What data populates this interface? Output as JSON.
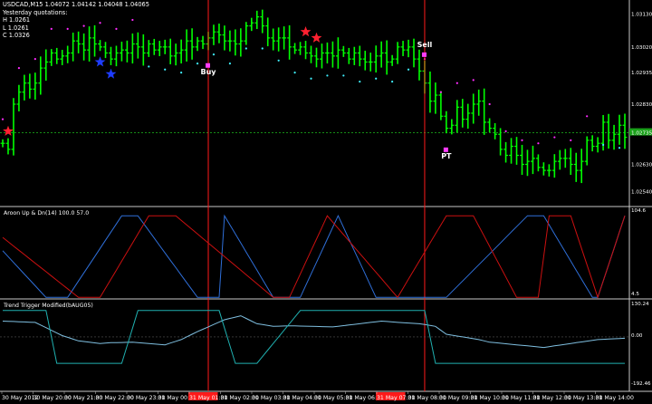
{
  "window": {
    "symbol_title": "USDCAD,M15",
    "ohlc_text": "1.04072 1.04142 1.04048 1.04065",
    "quote_lines": [
      "Yesterday quotations:",
      "H 1.0261",
      "L 1.0261",
      "C 1.0326"
    ]
  },
  "panels": {
    "aroon_title": "Aroon Up & Dn(14) 100.0 57.0",
    "trend_title": "Trend Trigger Modified(bAUG05)",
    "aroon_ticks": [
      "104.6",
      "4.5"
    ],
    "trend_ticks": [
      "130.24",
      "0.00",
      "-192.46"
    ]
  },
  "colors": {
    "bull": "#00ff00",
    "bear": "#ff0000",
    "aroon_up": "#2f6fd9",
    "aroon_dn": "#cc1010",
    "trend_line": "#7fbfe0",
    "trend_trigger": "#20b0b0",
    "grid": "#8a8a8a",
    "magenta_dots": "#ff2bff",
    "cyan_dots": "#3ff0ff",
    "vline": "#ff1a1a",
    "badge": "#ff1a1a",
    "signal_bar": "#ff3cff"
  },
  "chart_data": [
    {
      "type": "line",
      "title": "USDCAD,M15",
      "series_kind": "bar_chart",
      "price_labels": [
        "1.03130",
        "1.03020",
        "1.02935",
        "1.02830",
        "1.02735",
        "1.02735",
        "1.02630",
        "1.02540"
      ],
      "current_price": "1.02735",
      "ylim": [
        1.0249,
        1.0317
      ],
      "x_labels": [
        "30 May 2012",
        "30 May 20:00",
        "30 May 21:00",
        "30 May 22:00",
        "30 May 23:00",
        "31 May 00:00",
        "31 May 01:00",
        "31 May 02:00",
        "31 May 03:00",
        "31 May 04:00",
        "31 May 05:00",
        "31 May 06:00",
        "31 May 07:00",
        "31 May 08:00",
        "31 May 09:00",
        "31 May 10:00",
        "31 May 11:00",
        "31 May 12:00",
        "31 May 13:00",
        "31 May 14:00"
      ],
      "highlighted_x_labels": [
        "31 May 01:00",
        "31 May 07:00"
      ],
      "annotations": [
        {
          "text": "PT",
          "at": "31 May 03:00"
        },
        {
          "text": "Buy",
          "at": "31 May 00:45"
        },
        {
          "text": "Sell",
          "at": "31 May 07:15"
        },
        {
          "text": "PT",
          "at": "31 May 08:15"
        }
      ],
      "vertical_lines_at": [
        "31 May 00:45",
        "31 May 07:15"
      ],
      "closes": [
        1.027,
        1.0268,
        1.0283,
        1.0287,
        1.029,
        1.0288,
        1.029,
        1.0295,
        1.0297,
        1.03,
        1.0298,
        1.0299,
        1.03,
        1.0304,
        1.0303,
        1.0301,
        1.0305,
        1.0303,
        1.0302,
        1.03,
        1.0298,
        1.03,
        1.0301,
        1.03,
        1.0303,
        1.0302,
        1.03,
        1.0303,
        1.0301,
        1.0302,
        1.0302,
        1.0299,
        1.03,
        1.0301,
        1.0304,
        1.0302,
        1.0304,
        1.0303,
        1.0305,
        1.0307,
        1.0306,
        1.0304,
        1.0304,
        1.0303,
        1.0304,
        1.0309,
        1.031,
        1.0312,
        1.0309,
        1.0305,
        1.0304,
        1.0305,
        1.0305,
        1.0302,
        1.0301,
        1.0302,
        1.03,
        1.0299,
        1.0298,
        1.03,
        1.03,
        1.0299,
        1.0301,
        1.03,
        1.0298,
        1.03,
        1.0298,
        1.0297,
        1.0297,
        1.0299,
        1.03,
        1.0297,
        1.0298,
        1.0302,
        1.0301,
        1.0302,
        1.0298,
        1.0294,
        1.029,
        1.0284,
        1.0286,
        1.0279,
        1.0275,
        1.0276,
        1.0282,
        1.0278,
        1.028,
        1.0283,
        1.0284,
        1.0277,
        1.0275,
        1.0273,
        1.0268,
        1.0266,
        1.0269,
        1.0266,
        1.0263,
        1.0264,
        1.0265,
        1.0262,
        1.0261,
        1.0261,
        1.0264,
        1.0265,
        1.0265,
        1.0263,
        1.0261,
        1.0264,
        1.0271,
        1.0269,
        1.027,
        1.0277,
        1.0271,
        1.0273,
        1.0276,
        1.0272
      ]
    },
    {
      "type": "line",
      "title": "Aroon Up & Dn(14) 100.0 57.0",
      "ylim": [
        4.5,
        104.6
      ],
      "series": [
        {
          "name": "Aroon Up",
          "anchors_x": [
            0,
            8,
            12,
            22,
            25,
            36,
            40,
            41,
            50,
            55,
            62,
            69,
            70,
            78,
            82,
            97,
            100,
            109,
            110,
            115
          ],
          "values": [
            58,
            2,
            2,
            100,
            100,
            2,
            2,
            100,
            2,
            2,
            100,
            2,
            2,
            2,
            2,
            100,
            100,
            2,
            2,
            100
          ]
        },
        {
          "name": "Aroon Dn",
          "anchors_x": [
            0,
            14,
            18,
            27,
            32,
            50,
            53,
            60,
            73,
            82,
            87,
            95,
            99,
            101,
            105,
            110,
            115
          ],
          "values": [
            74,
            2,
            2,
            100,
            100,
            2,
            2,
            100,
            2,
            100,
            100,
            2,
            2,
            100,
            100,
            2,
            100
          ]
        }
      ]
    },
    {
      "type": "line",
      "title": "Trend Trigger Modified(bAUG05)",
      "ylim": [
        -192.46,
        130.24
      ],
      "series": [
        {
          "name": "Trend Trigger",
          "anchors_x": [
            0,
            6,
            8,
            11,
            14,
            18,
            20,
            24,
            30,
            33,
            36,
            41,
            44,
            47,
            50,
            53,
            57,
            61,
            66,
            70,
            73,
            77,
            80,
            82,
            88,
            90,
            95,
            100,
            105,
            110,
            115
          ],
          "values": [
            60,
            55,
            35,
            5,
            -15,
            -25,
            -22,
            -20,
            -30,
            -10,
            20,
            65,
            80,
            50,
            40,
            42,
            40,
            38,
            50,
            60,
            55,
            50,
            40,
            10,
            -10,
            -20,
            -30,
            -40,
            -25,
            -10,
            -5
          ]
        },
        {
          "name": "Trigger",
          "anchors_x": [
            0,
            8,
            10,
            14,
            22,
            25,
            28,
            40,
            43,
            47,
            55,
            61,
            63,
            70,
            78,
            80,
            83,
            100,
            115
          ],
          "values": [
            100,
            100,
            -100,
            -100,
            -100,
            100,
            100,
            100,
            -100,
            -100,
            100,
            100,
            100,
            100,
            100,
            -100,
            -100,
            -100,
            -100
          ]
        }
      ]
    }
  ]
}
